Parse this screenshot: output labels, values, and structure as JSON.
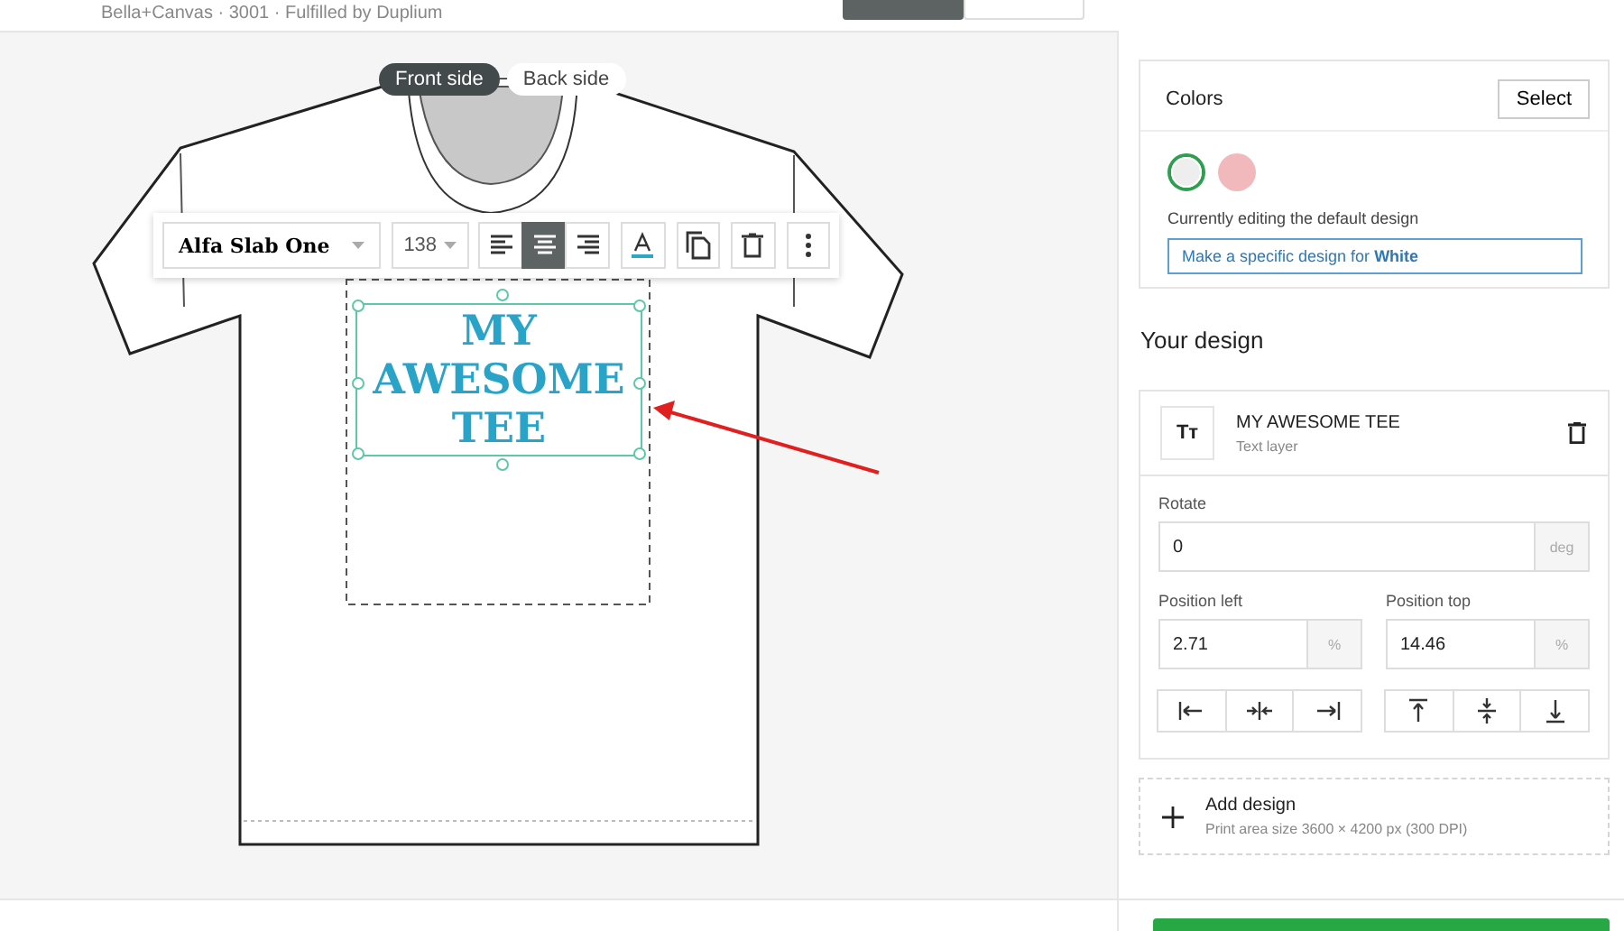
{
  "header": {
    "subtitle": "Bella+Canvas · 3001 · Fulfilled by Duplium",
    "mode_tabs": [
      {
        "selected": true
      },
      {
        "selected": false
      }
    ]
  },
  "side_tabs": [
    {
      "label": "Front side",
      "selected": true
    },
    {
      "label": "Back side",
      "selected": false
    }
  ],
  "toolbar": {
    "font": "Alfa Slab One",
    "size": "138",
    "align": [
      {
        "kind": "left",
        "selected": false
      },
      {
        "kind": "center",
        "selected": true
      },
      {
        "kind": "right",
        "selected": false
      }
    ]
  },
  "design_text": "MY AWESOME TEE",
  "colors": {
    "title": "Colors",
    "select": "Select",
    "swatches": [
      {
        "color": "#eeeeee",
        "selected": true
      },
      {
        "color": "#f2b9bd",
        "selected": false
      }
    ],
    "note": "Currently editing the default design",
    "specific": "Make a specific design for **White**"
  },
  "your_design": {
    "heading": "Your design",
    "layer": {
      "icon": "Tт",
      "name": "MY AWESOME TEE",
      "type": "Text layer"
    },
    "rotate": {
      "label": "Rotate",
      "value": "0",
      "unit": "deg"
    },
    "position_left": {
      "label": "Position left",
      "value": "2.71",
      "unit": "%"
    },
    "position_top": {
      "label": "Position top",
      "value": "14.46",
      "unit": "%"
    },
    "add": {
      "title": "Add design",
      "info": "Print area size 3600 × 4200 px (300 DPI)"
    }
  }
}
